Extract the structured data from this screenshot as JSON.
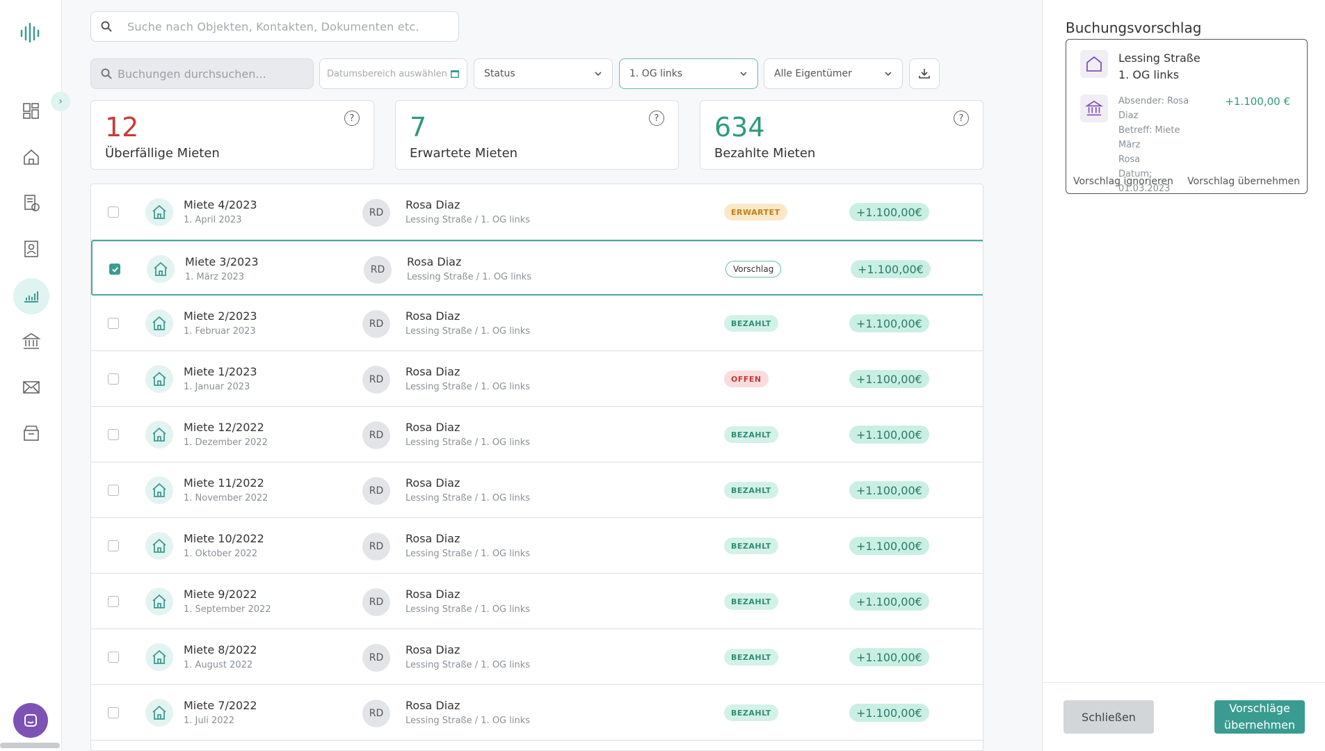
{
  "sidebar": {
    "items": [
      {
        "name": "dashboard-icon"
      },
      {
        "name": "home-icon"
      },
      {
        "name": "documents-icon"
      },
      {
        "name": "contacts-icon"
      },
      {
        "name": "chart-icon",
        "active": true
      },
      {
        "name": "bank-icon"
      },
      {
        "name": "mail-icon"
      },
      {
        "name": "archive-icon"
      }
    ]
  },
  "top_search": {
    "placeholder": "Suche nach Objekten, Kontakten, Dokumenten etc."
  },
  "filters": {
    "search_placeholder": "Buchungen durchsuchen...",
    "date_placeholder": "Datumsbereich auswählen",
    "status": "Status",
    "unit": "1. OG links",
    "owner": "Alle Eigentümer"
  },
  "stats": [
    {
      "value": "12",
      "label": "Überfällige Mieten",
      "color": "#c93a3a"
    },
    {
      "value": "7",
      "label": "Erwartete Mieten",
      "color": "#2d9a7c"
    },
    {
      "value": "634",
      "label": "Bezahlte Mieten",
      "color": "#2d9a7c"
    }
  ],
  "rows": [
    {
      "title": "Miete 4/2023",
      "date": "1. April 2023",
      "avatar": "RD",
      "name": "Rosa Diaz",
      "location": "Lessing Straße / 1. OG links",
      "status": "ERWARTET",
      "status_type": "erwartet",
      "amount": "+1.100,00€",
      "checked": false
    },
    {
      "title": "Miete 3/2023",
      "date": "1. März 2023",
      "avatar": "RD",
      "name": "Rosa Diaz",
      "location": "Lessing Straße / 1. OG links",
      "status": "Vorschlag",
      "status_type": "vorschlag",
      "amount": "+1.100,00€",
      "checked": true
    },
    {
      "title": "Miete 2/2023",
      "date": "1. Februar 2023",
      "avatar": "RD",
      "name": "Rosa Diaz",
      "location": "Lessing Straße / 1. OG links",
      "status": "BEZAHLT",
      "status_type": "bezahlt",
      "amount": "+1.100,00€",
      "checked": false
    },
    {
      "title": "Miete 1/2023",
      "date": "1. Januar 2023",
      "avatar": "RD",
      "name": "Rosa Diaz",
      "location": "Lessing Straße / 1. OG links",
      "status": "OFFEN",
      "status_type": "offen",
      "amount": "+1.100,00€",
      "checked": false
    },
    {
      "title": "Miete 12/2022",
      "date": "1. Dezember 2022",
      "avatar": "RD",
      "name": "Rosa Diaz",
      "location": "Lessing Straße / 1. OG links",
      "status": "BEZAHLT",
      "status_type": "bezahlt",
      "amount": "+1.100,00€",
      "checked": false
    },
    {
      "title": "Miete 11/2022",
      "date": "1. November 2022",
      "avatar": "RD",
      "name": "Rosa Diaz",
      "location": "Lessing Straße / 1. OG links",
      "status": "BEZAHLT",
      "status_type": "bezahlt",
      "amount": "+1.100,00€",
      "checked": false
    },
    {
      "title": "Miete 10/2022",
      "date": "1. Oktober 2022",
      "avatar": "RD",
      "name": "Rosa Diaz",
      "location": "Lessing Straße / 1. OG links",
      "status": "BEZAHLT",
      "status_type": "bezahlt",
      "amount": "+1.100,00€",
      "checked": false
    },
    {
      "title": "Miete 9/2022",
      "date": "1. September 2022",
      "avatar": "RD",
      "name": "Rosa Diaz",
      "location": "Lessing Straße / 1. OG links",
      "status": "BEZAHLT",
      "status_type": "bezahlt",
      "amount": "+1.100,00€",
      "checked": false
    },
    {
      "title": "Miete 8/2022",
      "date": "1. August 2022",
      "avatar": "RD",
      "name": "Rosa Diaz",
      "location": "Lessing Straße / 1. OG links",
      "status": "BEZAHLT",
      "status_type": "bezahlt",
      "amount": "+1.100,00€",
      "checked": false
    },
    {
      "title": "Miete 7/2022",
      "date": "1. Juli 2022",
      "avatar": "RD",
      "name": "Rosa Diaz",
      "location": "Lessing Straße / 1. OG links",
      "status": "BEZAHLT",
      "status_type": "bezahlt",
      "amount": "+1.100,00€",
      "checked": false
    }
  ],
  "panel": {
    "title": "Buchungsvorschlag",
    "street": "Lessing Straße",
    "unit": "1. OG links",
    "details": [
      "Absender: Rosa",
      "Diaz",
      "Betreff: Miete März",
      "Rosa",
      "Datum: 01.03.2023"
    ],
    "amount": "+1.100,00 €",
    "ignore_label": "Vorschlag ignorieren",
    "accept_label": "Vorschlag übernehmen",
    "close_label": "Schließen",
    "apply_label_1": "Vorschläge",
    "apply_label_2": "übernehmen"
  }
}
